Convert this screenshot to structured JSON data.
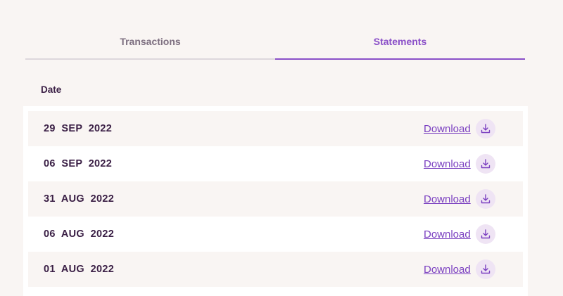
{
  "tabs": [
    {
      "label": "Transactions",
      "active": false
    },
    {
      "label": "Statements",
      "active": true
    }
  ],
  "table": {
    "column_header": "Date",
    "rows": [
      {
        "date": "29  SEP  2022",
        "action": "Download"
      },
      {
        "date": "06  SEP  2022",
        "action": "Download"
      },
      {
        "date": "31  AUG  2022",
        "action": "Download"
      },
      {
        "date": "06  AUG  2022",
        "action": "Download"
      },
      {
        "date": "01  AUG  2022",
        "action": "Download"
      }
    ]
  },
  "icons": {
    "download": "download-icon"
  },
  "colors": {
    "accent": "#8a4fc8",
    "link": "#7a3fc0",
    "text_dark": "#3a1f45",
    "tab_inactive": "#7d6f80",
    "row_shade": "#f9f5f3",
    "icon_bg": "#efe4f4"
  }
}
